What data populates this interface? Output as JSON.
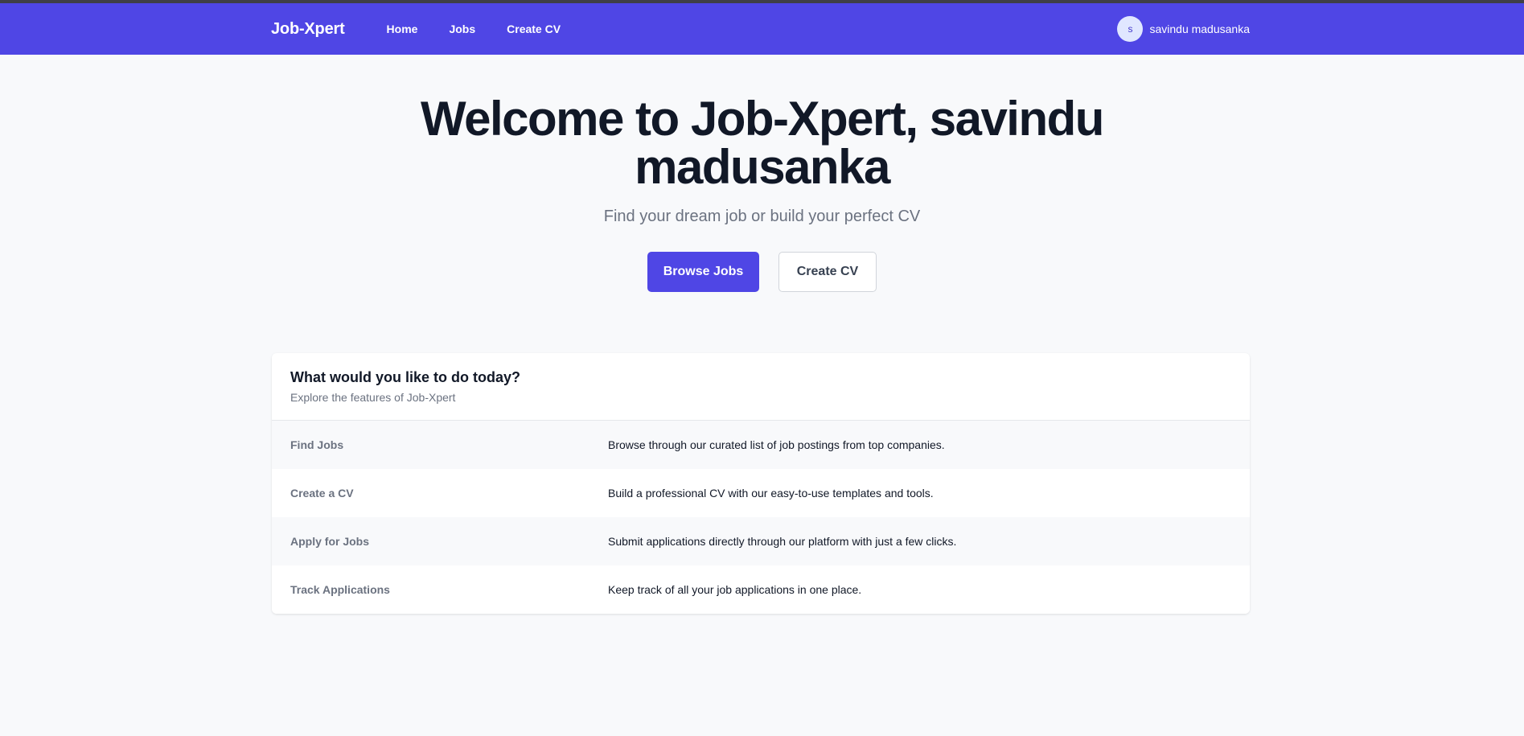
{
  "navbar": {
    "brand": "Job-Xpert",
    "links": [
      "Home",
      "Jobs",
      "Create CV"
    ],
    "user": {
      "initial": "s",
      "name": "savindu madusanka"
    },
    "color": "#4f46e5"
  },
  "hero": {
    "title": "Welcome to Job-Xpert, savindu madusanka",
    "subtitle": "Find your dream job or build your perfect CV",
    "primary_button": "Browse Jobs",
    "secondary_button": "Create CV"
  },
  "features": {
    "title": "What would you like to do today?",
    "subtitle": "Explore the features of Job-Xpert",
    "rows": [
      {
        "label": "Find Jobs",
        "description": "Browse through our curated list of job postings from top companies."
      },
      {
        "label": "Create a CV",
        "description": "Build a professional CV with our easy-to-use templates and tools."
      },
      {
        "label": "Apply for Jobs",
        "description": "Submit applications directly through our platform with just a few clicks."
      },
      {
        "label": "Track Applications",
        "description": "Keep track of all your job applications in one place."
      }
    ]
  }
}
